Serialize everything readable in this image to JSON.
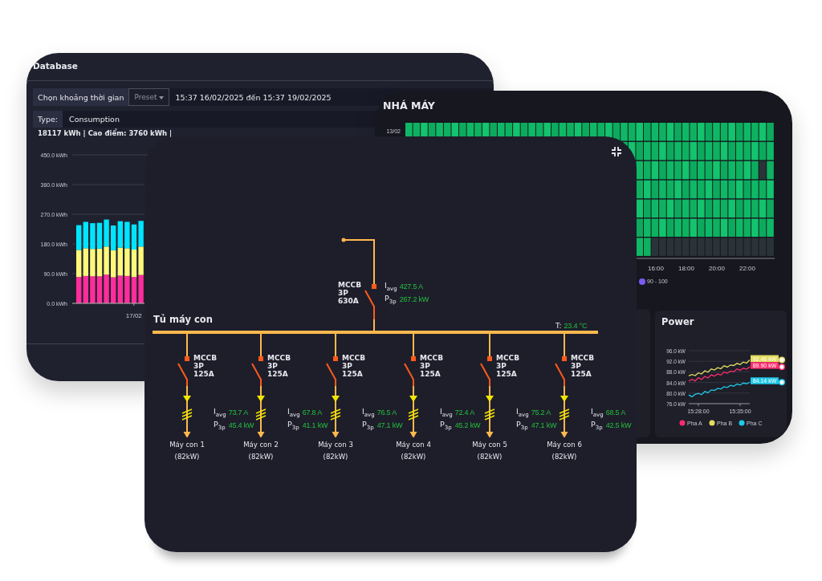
{
  "database_panel": {
    "title": "Database",
    "time_range": {
      "label": "Chọn khoảng thời gian",
      "preset": "Preset",
      "value": "15:37 16/02/2025 đến 15:37 19/02/2025"
    },
    "type": {
      "label": "Type:",
      "value": "Consumption"
    },
    "summary": "18117 kWh | Cao điểm: 3760 kWh |",
    "chart_data": {
      "type": "bar",
      "stacked": true,
      "grid": true,
      "categories": [
        null,
        null,
        null,
        null,
        null,
        null,
        null,
        null,
        "17/02",
        null
      ],
      "series": [
        {
          "color": "#ff2d9b",
          "values": [
            80,
            83,
            82,
            82,
            87,
            79,
            84,
            83,
            80,
            86
          ]
        },
        {
          "color": "#fff87a",
          "values": [
            82,
            84,
            83,
            84,
            85,
            82,
            85,
            84,
            83,
            86
          ]
        },
        {
          "color": "#00e5ff",
          "values": [
            75,
            80,
            78,
            78,
            82,
            75,
            80,
            80,
            76,
            78
          ]
        }
      ],
      "ylim": [
        0,
        450
      ],
      "yticks": [
        {
          "value": 0,
          "label": "0.0 kWh"
        },
        {
          "value": 90,
          "label": "90.0 kWh"
        },
        {
          "value": 180,
          "label": "180.0 kWh"
        },
        {
          "value": 270,
          "label": "270.0 kWh"
        },
        {
          "value": 360,
          "label": "360.0 kWh"
        },
        {
          "value": 450,
          "label": "450.0 kWh"
        }
      ]
    }
  },
  "factory_panel": {
    "title": "NHÁ MÁY",
    "heatmap": {
      "row_label": "13/02",
      "x_labels": [
        "16:00",
        "18:00",
        "20:00",
        "22:00"
      ],
      "legend": {
        "label": "90 - 100",
        "color": "#7b5cf0"
      }
    }
  },
  "power_panel": {
    "title": "Power",
    "chart_data": {
      "type": "line",
      "grid": true,
      "legend": true,
      "categories": [
        null,
        null,
        null,
        "15:28:00",
        null,
        null,
        null,
        null,
        null,
        null,
        null,
        null,
        null,
        null,
        null,
        null,
        "15:35:00",
        null,
        null,
        null
      ],
      "series": [
        {
          "name": "Pha A",
          "color": "#ff2d6f",
          "values": [
            84.5,
            85.2,
            84.6,
            85.8,
            85.1,
            86.3,
            85.7,
            86.9,
            86.4,
            87.2,
            86.8,
            87.9,
            87.5,
            88.3,
            88.0,
            89.1,
            88.6,
            89.4,
            89.0,
            89.9
          ]
        },
        {
          "name": "Pha B",
          "color": "#e3dc5f",
          "values": [
            86.5,
            87.0,
            86.6,
            87.6,
            87.2,
            88.4,
            87.9,
            89.1,
            88.7,
            89.6,
            89.2,
            90.3,
            89.8,
            90.6,
            90.4,
            91.2,
            90.8,
            91.7,
            91.3,
            92.5
          ]
        },
        {
          "name": "Pha C",
          "color": "#1ec8e6",
          "values": [
            79.3,
            78.6,
            79.5,
            79.9,
            79.4,
            80.6,
            80.1,
            81.2,
            81.0,
            81.8,
            81.5,
            82.4,
            82.1,
            82.9,
            82.6,
            83.4,
            83.0,
            83.8,
            83.5,
            84.1
          ]
        }
      ],
      "ylim": [
        76,
        96
      ],
      "yticks": [
        {
          "value": 76,
          "label": "76.0 kW"
        },
        {
          "value": 80,
          "label": "80.0 kW"
        },
        {
          "value": 84,
          "label": "84.0 kW"
        },
        {
          "value": 88,
          "label": "88.0 kW"
        },
        {
          "value": 92,
          "label": "92.0 kW"
        },
        {
          "value": 96,
          "label": "96.0 kW"
        }
      ],
      "annotations": [
        "92.46 kW",
        "89.90 kW",
        "84.14 kW"
      ]
    }
  },
  "distribution_panel": {
    "title": "Tủ máy con",
    "temperature": {
      "label": "T:",
      "value": "23.4 °C"
    },
    "main_breaker": {
      "type": "MCCB",
      "poles": "3P",
      "rating": "630A",
      "current_label": "I$_{avg}$",
      "current": "427.5 A",
      "power_label": "P$_{3p}$",
      "power": "267.2 kW"
    },
    "feeders": [
      {
        "type": "MCCB",
        "poles": "3P",
        "rating": "125A",
        "current_label": "I$_{avg}$",
        "current": "73.7 A",
        "power_label": "P$_{3p}$",
        "power": "45.4 kW",
        "name": "Máy con 1",
        "capacity": "(82kW)"
      },
      {
        "type": "MCCB",
        "poles": "3P",
        "rating": "125A",
        "current_label": "I$_{avg}$",
        "current": "67.8 A",
        "power_label": "P$_{3p}$",
        "power": "41.1 kW",
        "name": "Máy con 2",
        "capacity": "(82kW)"
      },
      {
        "type": "MCCB",
        "poles": "3P",
        "rating": "125A",
        "current_label": "I$_{avg}$",
        "current": "76.5 A",
        "power_label": "P$_{3p}$",
        "power": "47.1 kW",
        "name": "Máy con 3",
        "capacity": "(82kW)"
      },
      {
        "type": "MCCB",
        "poles": "3P",
        "rating": "125A",
        "current_label": "I$_{avg}$",
        "current": "72.4 A",
        "power_label": "P$_{3p}$",
        "power": "45.2 kW",
        "name": "Máy con 4",
        "capacity": "(82kW)"
      },
      {
        "type": "MCCB",
        "poles": "3P",
        "rating": "125A",
        "current_label": "I$_{avg}$",
        "current": "75.2 A",
        "power_label": "P$_{3p}$",
        "power": "47.1 kW",
        "name": "Máy con 5",
        "capacity": "(82kW)"
      },
      {
        "type": "MCCB",
        "poles": "3P",
        "rating": "125A",
        "current_label": "I$_{avg}$",
        "current": "68.5 A",
        "power_label": "P$_{3p}$",
        "power": "42.5 kW",
        "name": "Máy con 6",
        "capacity": "(82kW)"
      }
    ]
  }
}
